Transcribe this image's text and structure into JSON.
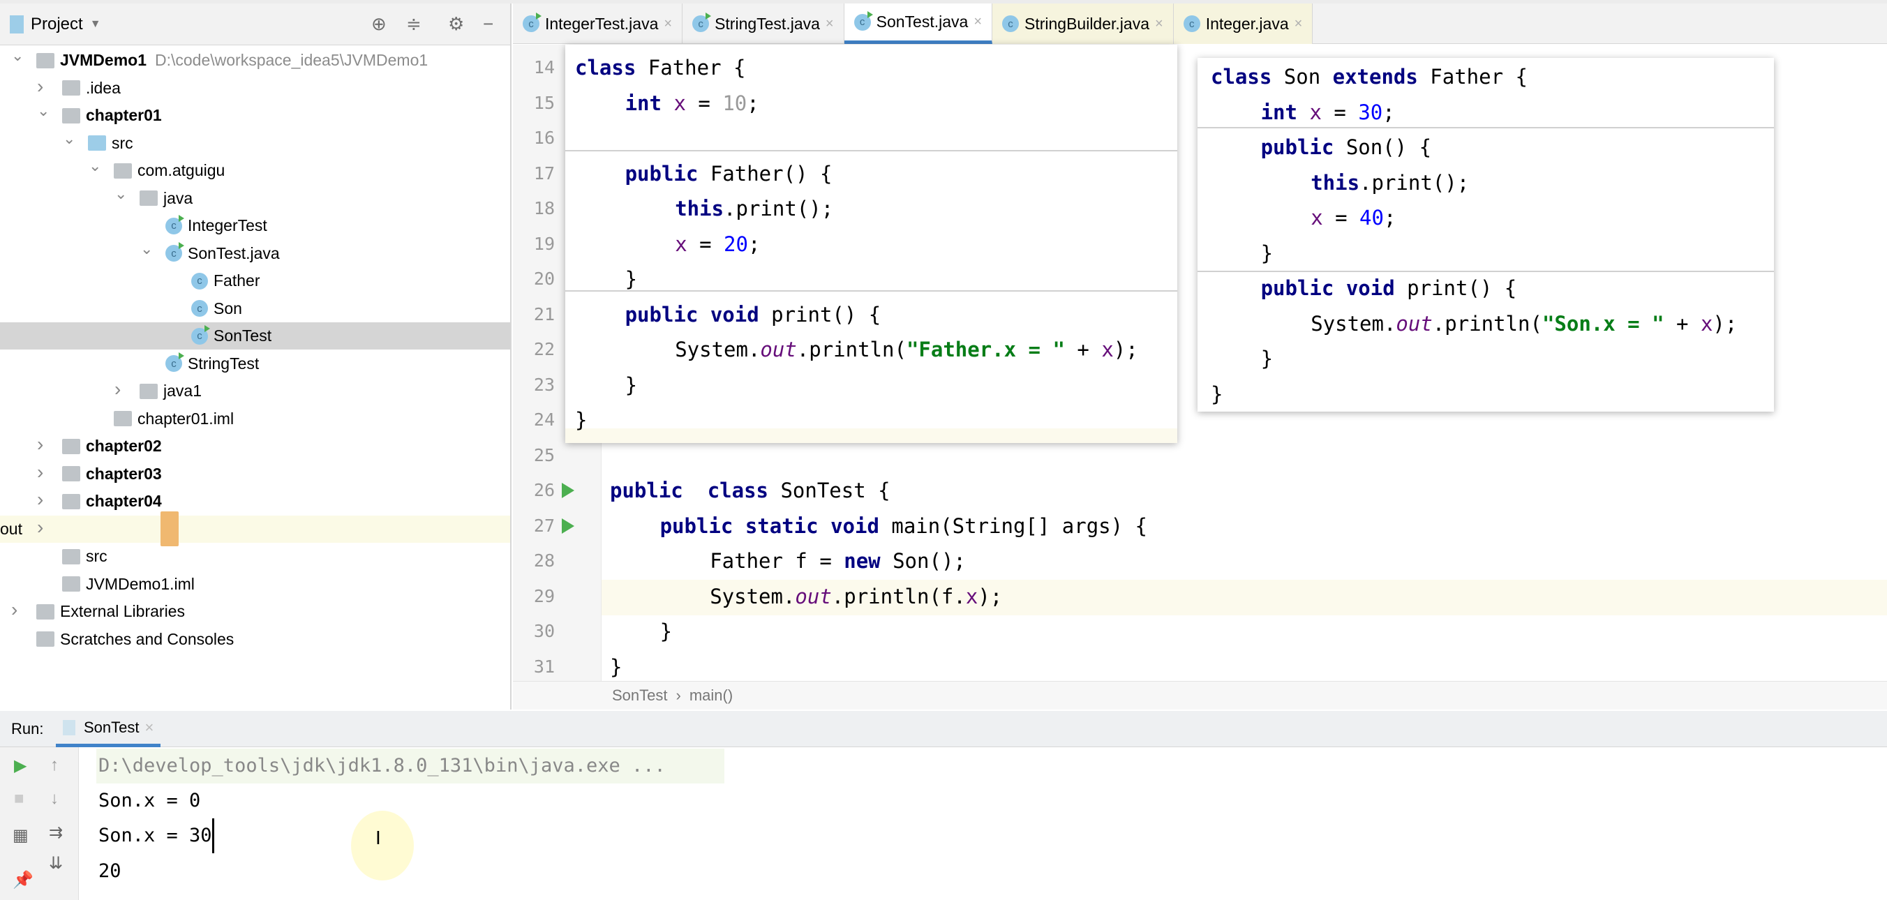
{
  "sidebar": {
    "title": "Project",
    "tree": [
      {
        "label": "JVMDemo1",
        "path": "D:\\code\\workspace_idea5\\JVMDemo1",
        "icon": "module-folder-icon",
        "expanded": true
      },
      {
        "label": ".idea",
        "icon": "folder-icon",
        "expanded": false
      },
      {
        "label": "chapter01",
        "icon": "module-folder-icon",
        "expanded": true
      },
      {
        "label": "src",
        "icon": "source-folder-icon",
        "expanded": true
      },
      {
        "label": "com.atguigu",
        "icon": "package-icon",
        "expanded": true
      },
      {
        "label": "java",
        "icon": "package-icon",
        "expanded": true
      },
      {
        "label": "IntegerTest",
        "icon": "runnable-class-icon"
      },
      {
        "label": "SonTest.java",
        "icon": "runnable-class-icon",
        "expanded": true
      },
      {
        "label": "Father",
        "icon": "class-icon"
      },
      {
        "label": "Son",
        "icon": "class-icon"
      },
      {
        "label": "SonTest",
        "icon": "runnable-class-icon",
        "selected": true
      },
      {
        "label": "StringTest",
        "icon": "runnable-class-icon"
      },
      {
        "label": "java1",
        "icon": "package-icon",
        "expanded": false
      },
      {
        "label": "chapter01.iml",
        "icon": "iml-file-icon"
      },
      {
        "label": "chapter02",
        "icon": "module-folder-icon",
        "expanded": false
      },
      {
        "label": "chapter03",
        "icon": "module-folder-icon",
        "expanded": false
      },
      {
        "label": "chapter04",
        "icon": "module-folder-icon",
        "expanded": false
      },
      {
        "label": "out",
        "icon": "excluded-folder-icon",
        "expanded": false
      },
      {
        "label": "src",
        "icon": "folder-icon"
      },
      {
        "label": "JVMDemo1.iml",
        "icon": "iml-file-icon"
      },
      {
        "label": "External Libraries",
        "icon": "library-icon",
        "expanded": false
      },
      {
        "label": "Scratches and Consoles",
        "icon": "scratches-icon"
      }
    ]
  },
  "tabs": [
    {
      "label": "IntegerTest.java"
    },
    {
      "label": "StringTest.java"
    },
    {
      "label": "SonTest.java",
      "active": true
    },
    {
      "label": "StringBuilder.java",
      "library": true
    },
    {
      "label": "Integer.java",
      "library": true
    }
  ],
  "editor": {
    "line_numbers": [
      "14",
      "15",
      "16",
      "17",
      "18",
      "19",
      "20",
      "21",
      "22",
      "23",
      "24",
      "25",
      "26",
      "27",
      "28",
      "29",
      "30",
      "31"
    ],
    "current_line": "29",
    "lines": [
      {
        "n": 26,
        "indent": 0,
        "tokens": [
          [
            "kw",
            "public"
          ],
          [
            "",
            "  "
          ],
          [
            "kw",
            "class"
          ],
          [
            "",
            " SonTest {"
          ]
        ]
      },
      {
        "n": 27,
        "indent": 4,
        "tokens": [
          [
            "kw",
            "public"
          ],
          [
            "",
            " "
          ],
          [
            "kw",
            "static"
          ],
          [
            "",
            " "
          ],
          [
            "kw",
            "void"
          ],
          [
            "",
            " main(String[] args) {"
          ]
        ]
      },
      {
        "n": 28,
        "indent": 8,
        "tokens": [
          [
            "",
            "Father f = "
          ],
          [
            "kw",
            "new"
          ],
          [
            "",
            " Son();"
          ]
        ]
      },
      {
        "n": 29,
        "indent": 8,
        "tokens": [
          [
            "",
            "System."
          ],
          [
            "st",
            "out"
          ],
          [
            "",
            ".println(f."
          ],
          [
            "fld",
            "x"
          ],
          [
            "",
            ");"
          ]
        ]
      },
      {
        "n": 30,
        "indent": 4,
        "tokens": [
          [
            "",
            "}"
          ]
        ]
      },
      {
        "n": 31,
        "indent": 0,
        "tokens": [
          [
            "",
            "}"
          ]
        ]
      }
    ],
    "father_popup": [
      {
        "n": 14,
        "indent": 0,
        "tokens": [
          [
            "kw",
            "class"
          ],
          [
            "",
            " Father {"
          ]
        ]
      },
      {
        "n": 15,
        "indent": 4,
        "tokens": [
          [
            "kw",
            "int"
          ],
          [
            "",
            " "
          ],
          [
            "fld",
            "x"
          ],
          [
            "",
            " = "
          ],
          [
            "numg",
            "10"
          ],
          [
            "",
            ";"
          ]
        ]
      },
      {
        "n": 16,
        "indent": 0,
        "tokens": []
      },
      {
        "n": 17,
        "indent": 4,
        "tokens": [
          [
            "kw",
            "public"
          ],
          [
            "",
            " Father() {"
          ]
        ]
      },
      {
        "n": 18,
        "indent": 8,
        "tokens": [
          [
            "kw",
            "this"
          ],
          [
            "",
            ".print();"
          ]
        ]
      },
      {
        "n": 19,
        "indent": 8,
        "tokens": [
          [
            "fld",
            "x"
          ],
          [
            "",
            " = "
          ],
          [
            "num",
            "20"
          ],
          [
            "",
            ";"
          ]
        ]
      },
      {
        "n": 20,
        "indent": 4,
        "tokens": [
          [
            "",
            "}"
          ]
        ]
      },
      {
        "n": 21,
        "indent": 4,
        "tokens": [
          [
            "kw",
            "public"
          ],
          [
            "",
            " "
          ],
          [
            "kw",
            "void"
          ],
          [
            "",
            " print() {"
          ]
        ]
      },
      {
        "n": 22,
        "indent": 8,
        "tokens": [
          [
            "",
            "System."
          ],
          [
            "st",
            "out"
          ],
          [
            "",
            ".println("
          ],
          [
            "str",
            "\"Father.x = \""
          ],
          [
            "",
            " + "
          ],
          [
            "fld",
            "x"
          ],
          [
            "",
            ");"
          ]
        ]
      },
      {
        "n": 23,
        "indent": 4,
        "tokens": [
          [
            "",
            "}"
          ]
        ]
      },
      {
        "n": 24,
        "indent": 0,
        "tokens": [
          [
            "",
            "}"
          ]
        ]
      }
    ],
    "son_popup": [
      {
        "indent": 0,
        "tokens": [
          [
            "kw",
            "class"
          ],
          [
            "",
            " Son "
          ],
          [
            "kw",
            "extends"
          ],
          [
            "",
            " Father {"
          ]
        ]
      },
      {
        "indent": 4,
        "tokens": [
          [
            "kw",
            "int"
          ],
          [
            "",
            " "
          ],
          [
            "fld",
            "x"
          ],
          [
            "",
            " = "
          ],
          [
            "num",
            "30"
          ],
          [
            "",
            ";"
          ]
        ]
      },
      {
        "indent": 4,
        "tokens": [
          [
            "kw",
            "public"
          ],
          [
            "",
            " Son() {"
          ]
        ]
      },
      {
        "indent": 8,
        "tokens": [
          [
            "kw",
            "this"
          ],
          [
            "",
            ".print();"
          ]
        ]
      },
      {
        "indent": 8,
        "tokens": [
          [
            "fld",
            "x"
          ],
          [
            "",
            " = "
          ],
          [
            "num",
            "40"
          ],
          [
            "",
            ";"
          ]
        ]
      },
      {
        "indent": 4,
        "tokens": [
          [
            "",
            "}"
          ]
        ]
      },
      {
        "indent": 4,
        "tokens": [
          [
            "kw",
            "public"
          ],
          [
            "",
            " "
          ],
          [
            "kw",
            "void"
          ],
          [
            "",
            " print() {"
          ]
        ]
      },
      {
        "indent": 8,
        "tokens": [
          [
            "",
            "System."
          ],
          [
            "st",
            "out"
          ],
          [
            "",
            ".println("
          ],
          [
            "str",
            "\"Son.x = \""
          ],
          [
            "",
            " + "
          ],
          [
            "fld",
            "x"
          ],
          [
            "",
            ");"
          ]
        ]
      },
      {
        "indent": 4,
        "tokens": [
          [
            "",
            "}"
          ]
        ]
      },
      {
        "indent": 0,
        "tokens": [
          [
            "",
            "}"
          ]
        ]
      }
    ],
    "breadcrumb": [
      "SonTest",
      "main()"
    ]
  },
  "run": {
    "label": "Run:",
    "tab": "SonTest",
    "command": "D:\\develop_tools\\jdk\\jdk1.8.0_131\\bin\\java.exe ...",
    "output": [
      "Son.x = 0",
      "Son.x = 30",
      "20"
    ]
  },
  "colors": {
    "accent": "#4083c9",
    "keyword": "#000080",
    "field": "#660e7a",
    "number": "#0000ff",
    "string": "#067d17"
  }
}
